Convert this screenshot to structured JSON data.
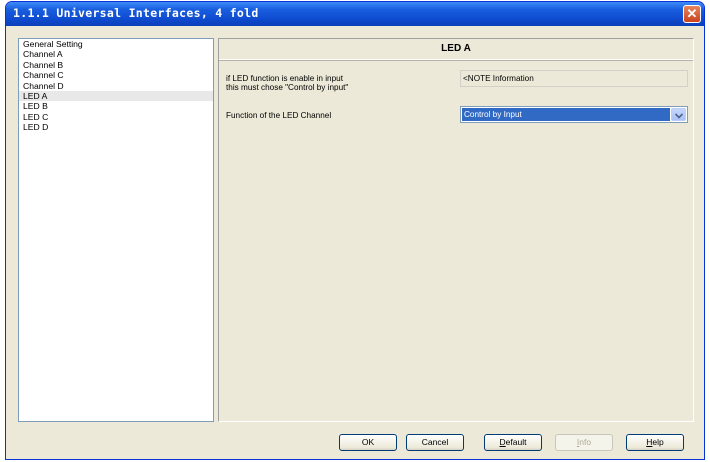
{
  "window": {
    "title": "1.1.1 Universal Interfaces, 4 fold",
    "close_glyph": "✕"
  },
  "sidebar": {
    "items": [
      {
        "label": "General Setting",
        "selected": false
      },
      {
        "label": "Channel A",
        "selected": false
      },
      {
        "label": "Channel B",
        "selected": false
      },
      {
        "label": "Channel C",
        "selected": false
      },
      {
        "label": "Channel D",
        "selected": false
      },
      {
        "label": "LED A",
        "selected": true
      },
      {
        "label": "LED B",
        "selected": false
      },
      {
        "label": "LED C",
        "selected": false
      },
      {
        "label": "LED D",
        "selected": false
      }
    ]
  },
  "panel": {
    "title": "LED A",
    "note_label_line1": "if LED function is enable in input",
    "note_label_line2": "this must chose \"Control by input\"",
    "note_value": "<NOTE Information",
    "function_label": "Function of the LED Channel",
    "function_value": "Control by Input"
  },
  "buttons": {
    "ok": "OK",
    "cancel": "Cancel",
    "default_first": "D",
    "default_rest": "efault",
    "info_first": "I",
    "info_rest": "nfo",
    "help_first": "H",
    "help_rest": "elp"
  },
  "icons": {
    "close": "close-icon",
    "dropdown": "chevron-down-icon"
  },
  "colors": {
    "titlebar": "#0f4bd0",
    "selection": "#316ac5",
    "close": "#c9431e",
    "face": "#ece9d8"
  }
}
